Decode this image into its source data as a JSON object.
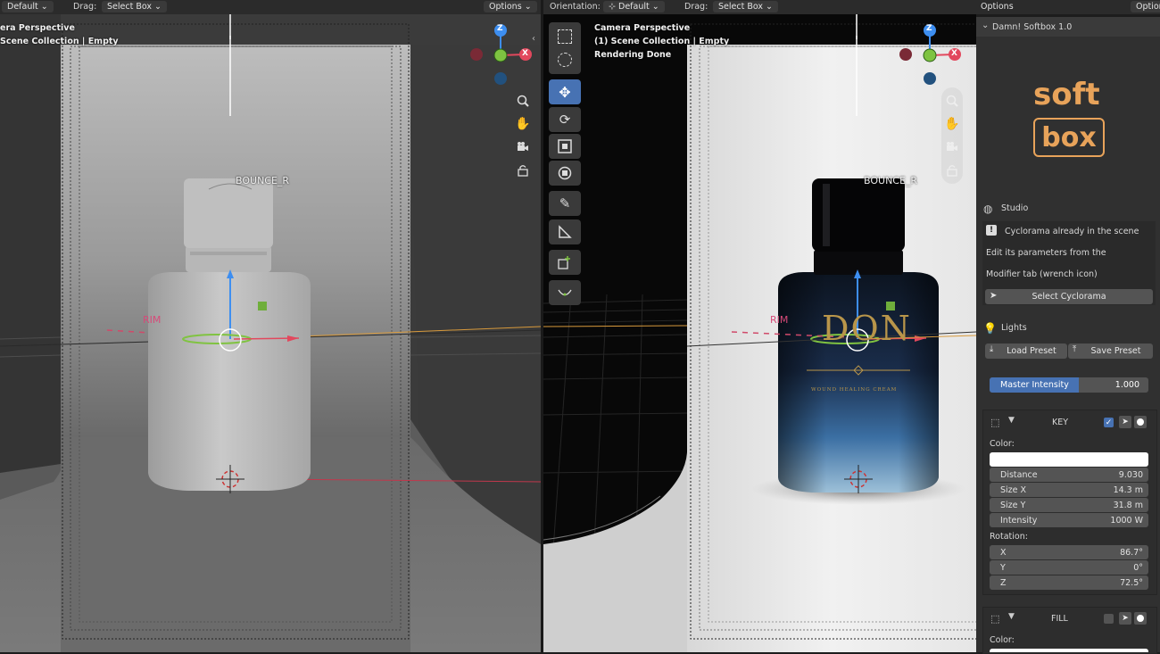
{
  "left_header": {
    "mode": "Default",
    "drag_label": "Drag:",
    "drag_value": "Select Box",
    "options": "Options"
  },
  "right_header": {
    "orientation_label": "Orientation:",
    "orientation_value": "Default",
    "drag_label": "Drag:",
    "drag_value": "Select Box",
    "options": "Options",
    "options2": "Option"
  },
  "left_viewport": {
    "line1": "era Perspective",
    "line2": "Scene Collection | Empty",
    "bounce_label": "BOUNCE_R",
    "rim_label": "RIM"
  },
  "right_viewport": {
    "line1": "Camera Perspective",
    "line2": "(1) Scene Collection | Empty",
    "line3": "Rendering Done",
    "bounce_label": "BOUNCE_R",
    "rim_label": "RIM",
    "bottle_brand": "DON",
    "bottle_sub": "WOUND HEALING CREAM"
  },
  "gizmo": {
    "z": "Z",
    "x": "X"
  },
  "panel": {
    "title": "Damn! Softbox 1.0",
    "logo_top": "soft",
    "logo_bottom": "box",
    "studio": {
      "label": "Studio",
      "info1": "Cyclorama already in the scene",
      "info2": "Edit its parameters from the",
      "info3": "Modifier tab (wrench icon)",
      "select_button": "Select Cyclorama"
    },
    "lights": {
      "label": "Lights",
      "load_preset": "Load Preset",
      "save_preset": "Save Preset",
      "master_label": "Master Intensity",
      "master_value": "1.000"
    },
    "key": {
      "name": "KEY",
      "enabled": true,
      "color_label": "Color:",
      "color": "#ffffff",
      "distance_label": "Distance",
      "distance": "9.030",
      "sizex_label": "Size X",
      "sizex": "14.3 m",
      "sizey_label": "Size Y",
      "sizey": "31.8 m",
      "intensity_label": "Intensity",
      "intensity": "1000 W",
      "rotation_label": "Rotation:",
      "rx_label": "X",
      "rx": "86.7°",
      "ry_label": "Y",
      "ry": "0°",
      "rz_label": "Z",
      "rz": "72.5°"
    },
    "fill": {
      "name": "FILL",
      "enabled": false,
      "color_label": "Color:"
    }
  },
  "colors": {
    "accent": "#4772b3",
    "axis_x": "#e2485d",
    "axis_y": "#80c341",
    "axis_z": "#3d8ef0",
    "logo": "#e8a35a"
  }
}
